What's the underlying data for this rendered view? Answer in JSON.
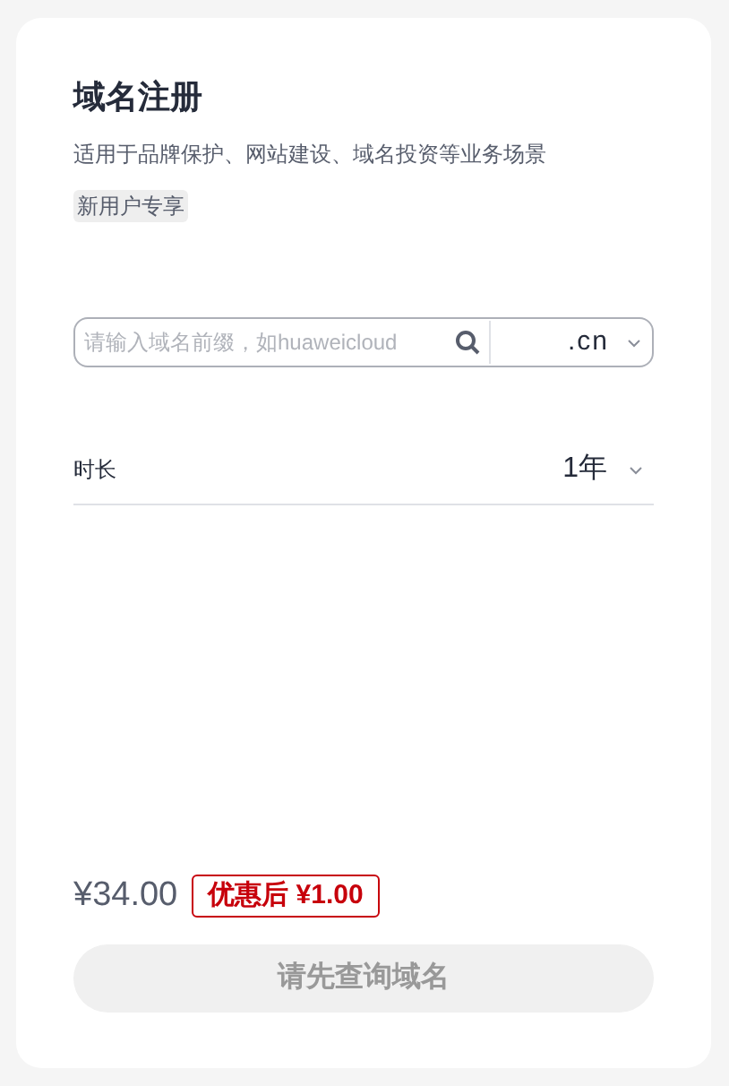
{
  "title": "域名注册",
  "subtitle": "适用于品牌保护、网站建设、域名投资等业务场景",
  "tag": "新用户专享",
  "search": {
    "placeholder": "请输入域名前缀，如huaweicloud",
    "suffix": ".cn"
  },
  "duration": {
    "label": "时长",
    "value": "1年"
  },
  "price": {
    "original": "¥34.00",
    "discount": "优惠后 ¥1.00"
  },
  "submit_button": {
    "label": "请先查询域名",
    "disabled": true
  }
}
